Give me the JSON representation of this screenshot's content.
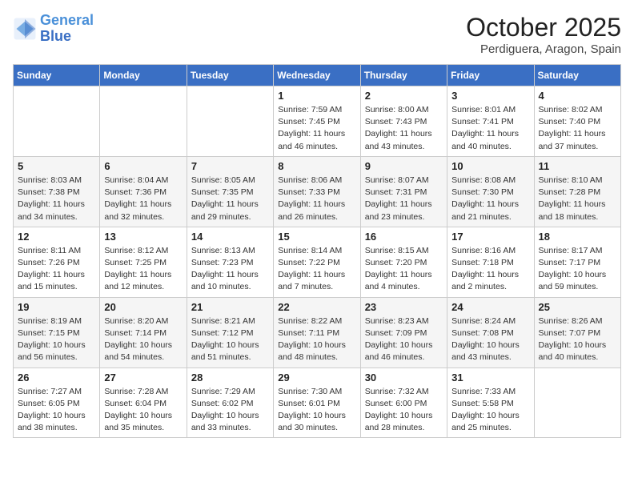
{
  "header": {
    "logo_line1": "General",
    "logo_line2": "Blue",
    "month": "October 2025",
    "location": "Perdiguera, Aragon, Spain"
  },
  "days_of_week": [
    "Sunday",
    "Monday",
    "Tuesday",
    "Wednesday",
    "Thursday",
    "Friday",
    "Saturday"
  ],
  "weeks": [
    [
      {
        "day": "",
        "info": ""
      },
      {
        "day": "",
        "info": ""
      },
      {
        "day": "",
        "info": ""
      },
      {
        "day": "1",
        "info": "Sunrise: 7:59 AM\nSunset: 7:45 PM\nDaylight: 11 hours and 46 minutes."
      },
      {
        "day": "2",
        "info": "Sunrise: 8:00 AM\nSunset: 7:43 PM\nDaylight: 11 hours and 43 minutes."
      },
      {
        "day": "3",
        "info": "Sunrise: 8:01 AM\nSunset: 7:41 PM\nDaylight: 11 hours and 40 minutes."
      },
      {
        "day": "4",
        "info": "Sunrise: 8:02 AM\nSunset: 7:40 PM\nDaylight: 11 hours and 37 minutes."
      }
    ],
    [
      {
        "day": "5",
        "info": "Sunrise: 8:03 AM\nSunset: 7:38 PM\nDaylight: 11 hours and 34 minutes."
      },
      {
        "day": "6",
        "info": "Sunrise: 8:04 AM\nSunset: 7:36 PM\nDaylight: 11 hours and 32 minutes."
      },
      {
        "day": "7",
        "info": "Sunrise: 8:05 AM\nSunset: 7:35 PM\nDaylight: 11 hours and 29 minutes."
      },
      {
        "day": "8",
        "info": "Sunrise: 8:06 AM\nSunset: 7:33 PM\nDaylight: 11 hours and 26 minutes."
      },
      {
        "day": "9",
        "info": "Sunrise: 8:07 AM\nSunset: 7:31 PM\nDaylight: 11 hours and 23 minutes."
      },
      {
        "day": "10",
        "info": "Sunrise: 8:08 AM\nSunset: 7:30 PM\nDaylight: 11 hours and 21 minutes."
      },
      {
        "day": "11",
        "info": "Sunrise: 8:10 AM\nSunset: 7:28 PM\nDaylight: 11 hours and 18 minutes."
      }
    ],
    [
      {
        "day": "12",
        "info": "Sunrise: 8:11 AM\nSunset: 7:26 PM\nDaylight: 11 hours and 15 minutes."
      },
      {
        "day": "13",
        "info": "Sunrise: 8:12 AM\nSunset: 7:25 PM\nDaylight: 11 hours and 12 minutes."
      },
      {
        "day": "14",
        "info": "Sunrise: 8:13 AM\nSunset: 7:23 PM\nDaylight: 11 hours and 10 minutes."
      },
      {
        "day": "15",
        "info": "Sunrise: 8:14 AM\nSunset: 7:22 PM\nDaylight: 11 hours and 7 minutes."
      },
      {
        "day": "16",
        "info": "Sunrise: 8:15 AM\nSunset: 7:20 PM\nDaylight: 11 hours and 4 minutes."
      },
      {
        "day": "17",
        "info": "Sunrise: 8:16 AM\nSunset: 7:18 PM\nDaylight: 11 hours and 2 minutes."
      },
      {
        "day": "18",
        "info": "Sunrise: 8:17 AM\nSunset: 7:17 PM\nDaylight: 10 hours and 59 minutes."
      }
    ],
    [
      {
        "day": "19",
        "info": "Sunrise: 8:19 AM\nSunset: 7:15 PM\nDaylight: 10 hours and 56 minutes."
      },
      {
        "day": "20",
        "info": "Sunrise: 8:20 AM\nSunset: 7:14 PM\nDaylight: 10 hours and 54 minutes."
      },
      {
        "day": "21",
        "info": "Sunrise: 8:21 AM\nSunset: 7:12 PM\nDaylight: 10 hours and 51 minutes."
      },
      {
        "day": "22",
        "info": "Sunrise: 8:22 AM\nSunset: 7:11 PM\nDaylight: 10 hours and 48 minutes."
      },
      {
        "day": "23",
        "info": "Sunrise: 8:23 AM\nSunset: 7:09 PM\nDaylight: 10 hours and 46 minutes."
      },
      {
        "day": "24",
        "info": "Sunrise: 8:24 AM\nSunset: 7:08 PM\nDaylight: 10 hours and 43 minutes."
      },
      {
        "day": "25",
        "info": "Sunrise: 8:26 AM\nSunset: 7:07 PM\nDaylight: 10 hours and 40 minutes."
      }
    ],
    [
      {
        "day": "26",
        "info": "Sunrise: 7:27 AM\nSunset: 6:05 PM\nDaylight: 10 hours and 38 minutes."
      },
      {
        "day": "27",
        "info": "Sunrise: 7:28 AM\nSunset: 6:04 PM\nDaylight: 10 hours and 35 minutes."
      },
      {
        "day": "28",
        "info": "Sunrise: 7:29 AM\nSunset: 6:02 PM\nDaylight: 10 hours and 33 minutes."
      },
      {
        "day": "29",
        "info": "Sunrise: 7:30 AM\nSunset: 6:01 PM\nDaylight: 10 hours and 30 minutes."
      },
      {
        "day": "30",
        "info": "Sunrise: 7:32 AM\nSunset: 6:00 PM\nDaylight: 10 hours and 28 minutes."
      },
      {
        "day": "31",
        "info": "Sunrise: 7:33 AM\nSunset: 5:58 PM\nDaylight: 10 hours and 25 minutes."
      },
      {
        "day": "",
        "info": ""
      }
    ]
  ]
}
